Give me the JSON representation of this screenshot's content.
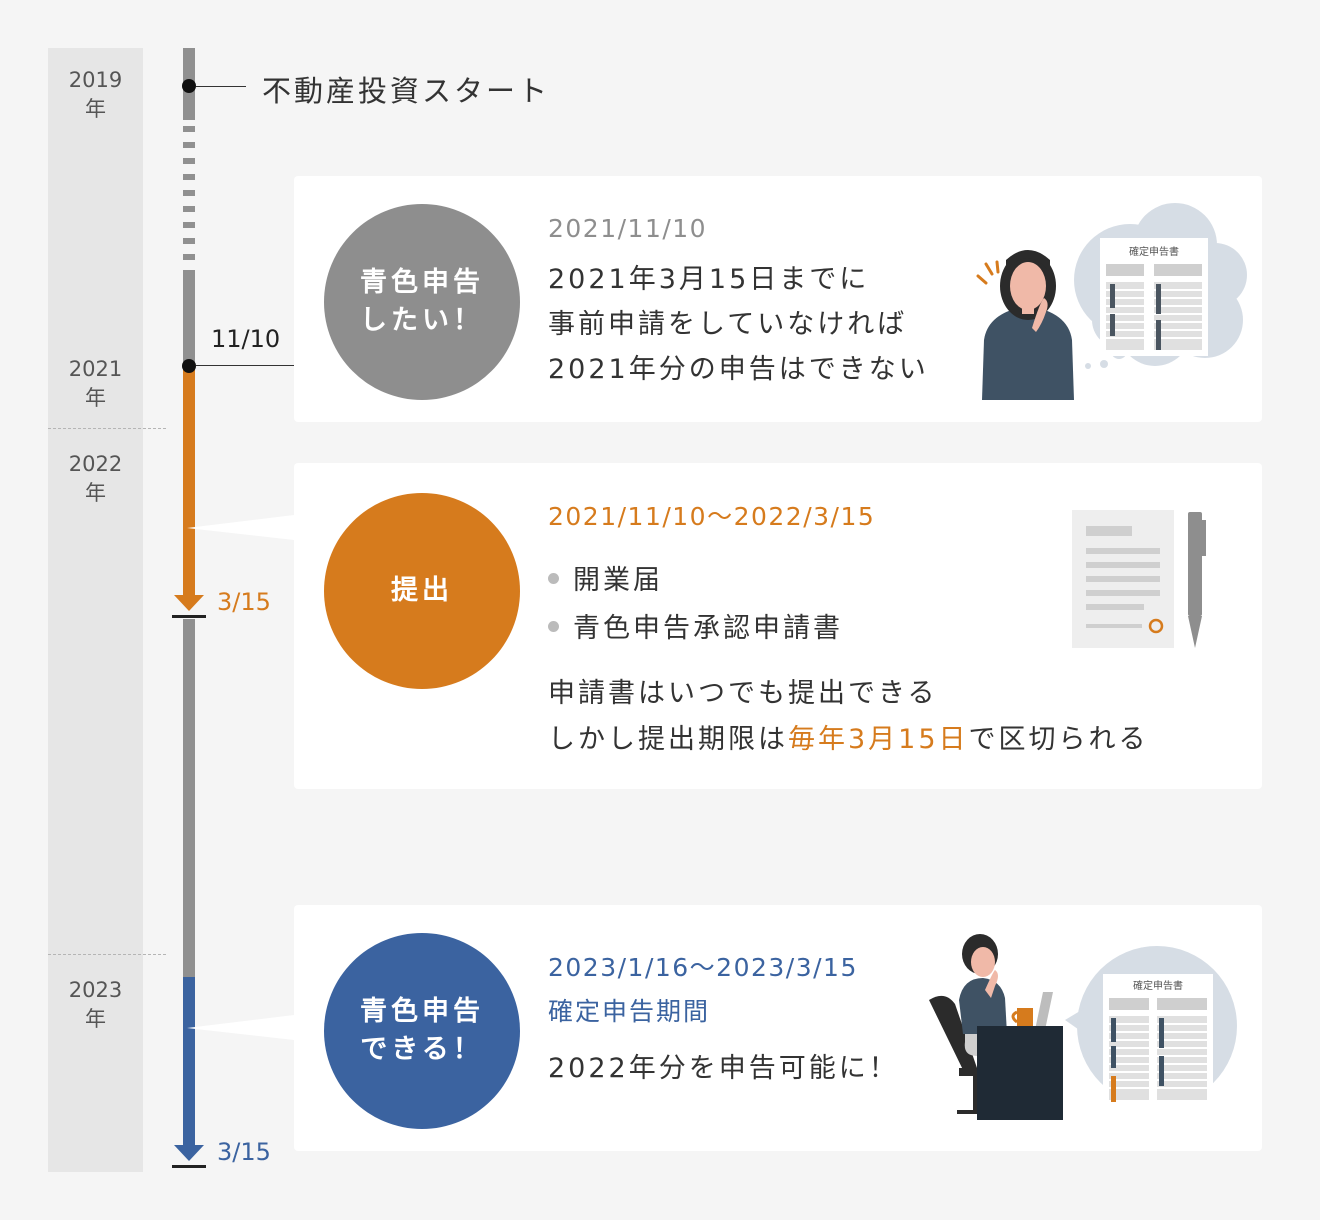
{
  "years": [
    "2019\n年",
    "2021\n年",
    "2022\n年",
    "2023\n年"
  ],
  "timeline": {
    "start_label": "不動産投資スタート",
    "date_1110": "11/10",
    "deadline_1": "3/15",
    "deadline_2": "3/15"
  },
  "cards": [
    {
      "circle": "青色申告\nしたい！",
      "date": "2021/11/10",
      "lines": [
        "2021年3月15日までに",
        "事前申請をしていなければ",
        "2021年分の申告はできない"
      ],
      "doc_title": "確定申告書"
    },
    {
      "circle": "提出",
      "date": "2021/11/10〜2022/3/15",
      "bullets": [
        "開業届",
        "青色申告承認申請書"
      ],
      "line1": "申請書はいつでも提出できる",
      "line2_before": "しかし提出期限は",
      "line2_highlight": "毎年3月15日",
      "line2_after": "で区切られる"
    },
    {
      "circle": "青色申告\nできる！",
      "date": "2023/1/16〜2023/3/15",
      "period": "確定申告期間",
      "line": "2022年分を申告可能に！",
      "doc_title": "確定申告書"
    }
  ],
  "colors": {
    "gray": "#8e8e8e",
    "orange": "#d67b1d",
    "blue": "#3b63a0",
    "background": "#f5f5f5"
  }
}
